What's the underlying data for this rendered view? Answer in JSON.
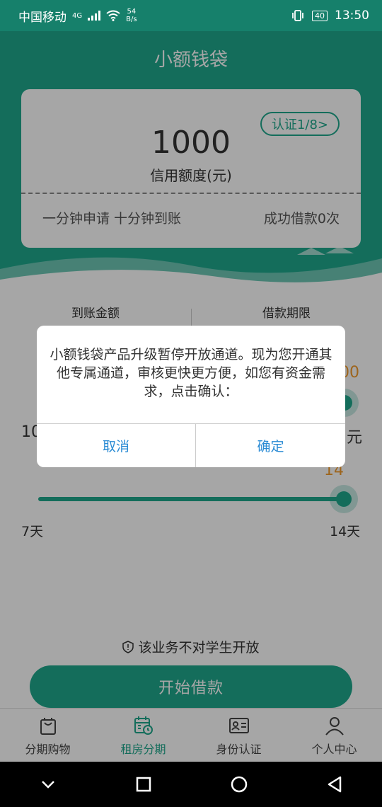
{
  "status_bar": {
    "carrier": "中国移动",
    "net_type": "4G",
    "speed_value": "54",
    "speed_unit": "B/s",
    "battery": "40",
    "time": "13:50"
  },
  "header": {
    "title": "小额钱袋"
  },
  "card": {
    "auth_badge": "认证1/8>",
    "amount": "1000",
    "amount_label": "信用额度(元)",
    "slogan": "一分钟申请 十分钟到账",
    "success_count": "成功借款0次"
  },
  "loan": {
    "receive_label": "到账金额",
    "receive_value": "1000元",
    "term_label": "借款期限",
    "term_value": "14天",
    "amount_slider": {
      "min_label": "10",
      "max_peek": "00",
      "unit_peek": "元"
    },
    "term_slider": {
      "value_label": "14",
      "min_label": "7天",
      "max_label": "14天",
      "min": 7,
      "max": 14,
      "value": 14
    }
  },
  "notice": "该业务不对学生开放",
  "cta": {
    "label": "开始借款"
  },
  "tabs": [
    {
      "label": "分期购物",
      "icon": "shopping-bag-icon",
      "active": false
    },
    {
      "label": "租房分期",
      "icon": "calendar-clock-icon",
      "active": true
    },
    {
      "label": "身份认证",
      "icon": "id-card-icon",
      "active": false
    },
    {
      "label": "个人中心",
      "icon": "user-icon",
      "active": false
    }
  ],
  "dialog": {
    "message": "小额钱袋产品升级暂停开放通道。现为您开通其他专属通道，审核更快更方便，如您有资金需求，点击确认：",
    "cancel": "取消",
    "confirm": "确定"
  },
  "colors": {
    "primary": "#1fa88d",
    "accent": "#f29b2d",
    "link": "#2a8bd4"
  }
}
